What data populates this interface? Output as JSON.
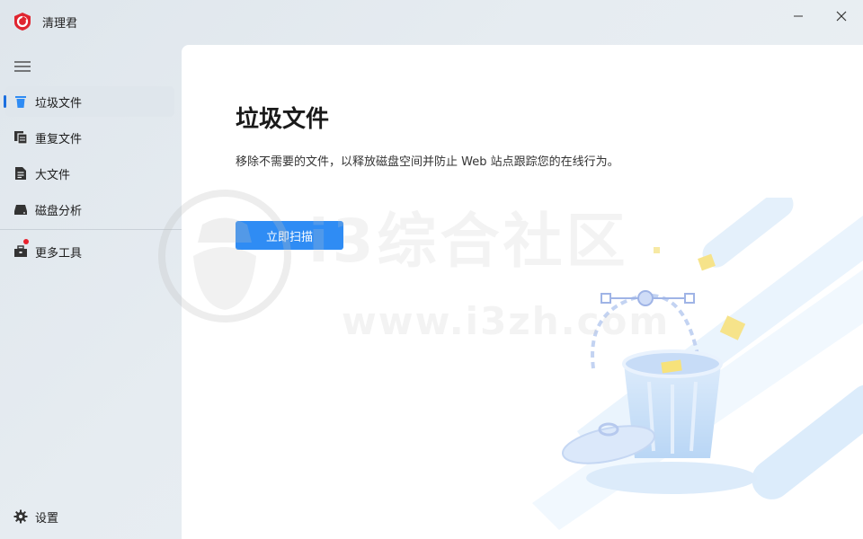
{
  "titlebar": {
    "app_title": "清理君",
    "logo_color": "#e02530"
  },
  "sidebar": {
    "items": [
      {
        "label": "垃圾文件",
        "icon": "trash-icon",
        "active": true
      },
      {
        "label": "重复文件",
        "icon": "duplicate-files-icon",
        "active": false
      },
      {
        "label": "大文件",
        "icon": "large-file-icon",
        "active": false
      },
      {
        "label": "磁盘分析",
        "icon": "disk-icon",
        "active": false
      },
      {
        "label": "更多工具",
        "icon": "toolbox-icon",
        "active": false,
        "badge": true
      }
    ],
    "settings_label": "设置"
  },
  "main": {
    "title": "垃圾文件",
    "description": "移除不需要的文件，以释放磁盘空间并防止 Web 站点跟踪您的在线行为。",
    "scan_button": "立即扫描"
  },
  "watermark": {
    "text": "i3综合社区",
    "url": "www.i3zh.com"
  },
  "colors": {
    "accent": "#2f8cf4",
    "active_indicator": "#1b6fe0",
    "badge": "#e8222d"
  }
}
